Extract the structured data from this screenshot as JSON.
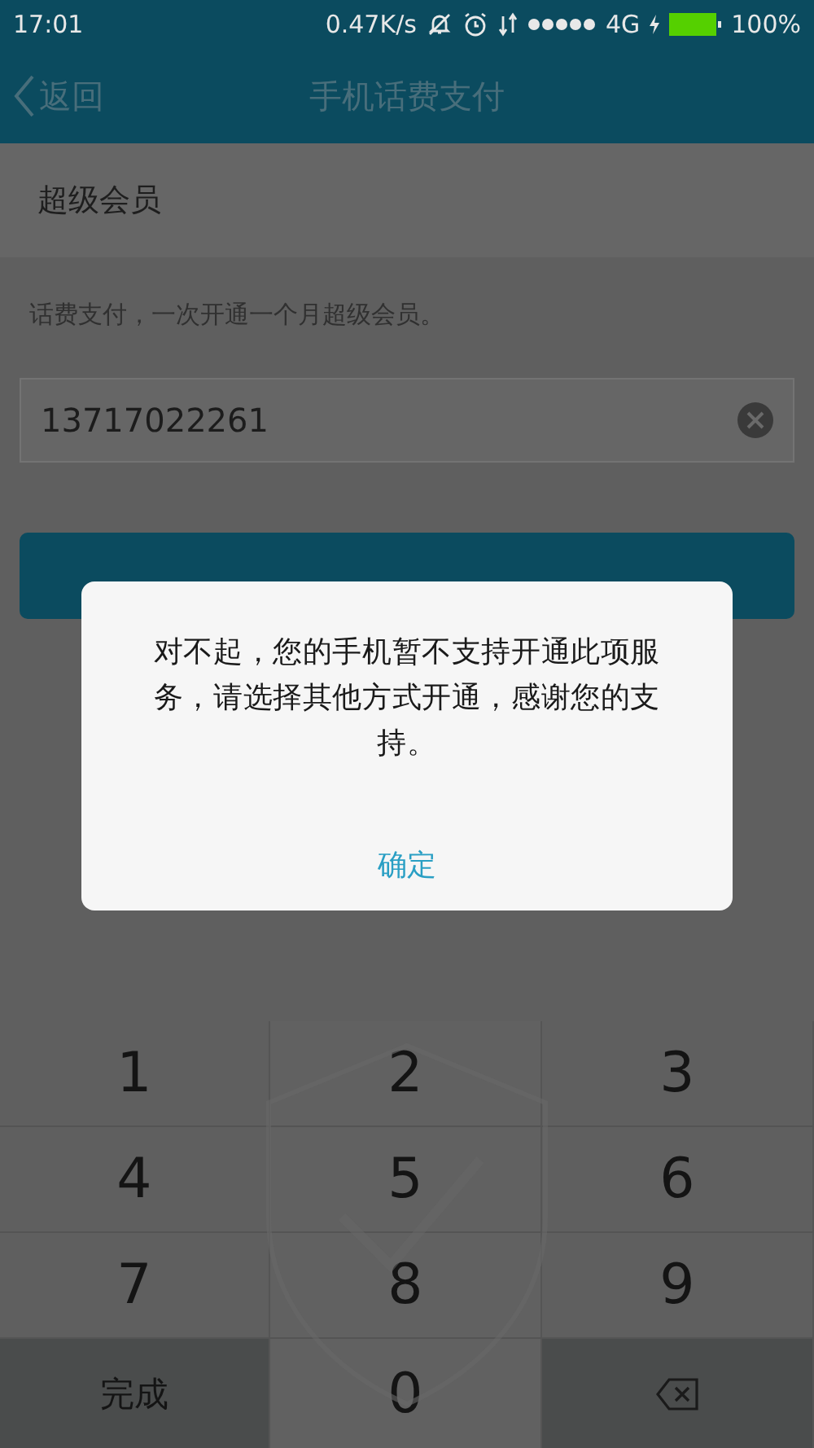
{
  "status_bar": {
    "time": "17:01",
    "speed": "0.47K/s",
    "network": "4G",
    "battery": "100%"
  },
  "nav": {
    "back": "返回",
    "title": "手机话费支付"
  },
  "section": {
    "title": "超级会员"
  },
  "description": "话费支付，一次开通一个月超级会员。",
  "phone_field": {
    "value": "13717022261"
  },
  "dialog": {
    "message": "对不起，您的手机暂不支持开通此项服务，请选择其他方式开通，感谢您的支持。",
    "confirm": "确定"
  },
  "keypad": [
    {
      "kind": "digit",
      "label": "1"
    },
    {
      "kind": "digit",
      "label": "2"
    },
    {
      "kind": "digit",
      "label": "3"
    },
    {
      "kind": "digit",
      "label": "4"
    },
    {
      "kind": "digit",
      "label": "5"
    },
    {
      "kind": "digit",
      "label": "6"
    },
    {
      "kind": "digit",
      "label": "7"
    },
    {
      "kind": "digit",
      "label": "8"
    },
    {
      "kind": "digit",
      "label": "9"
    },
    {
      "kind": "action",
      "label": "完成"
    },
    {
      "kind": "digit",
      "label": "0"
    },
    {
      "kind": "backspace"
    }
  ]
}
